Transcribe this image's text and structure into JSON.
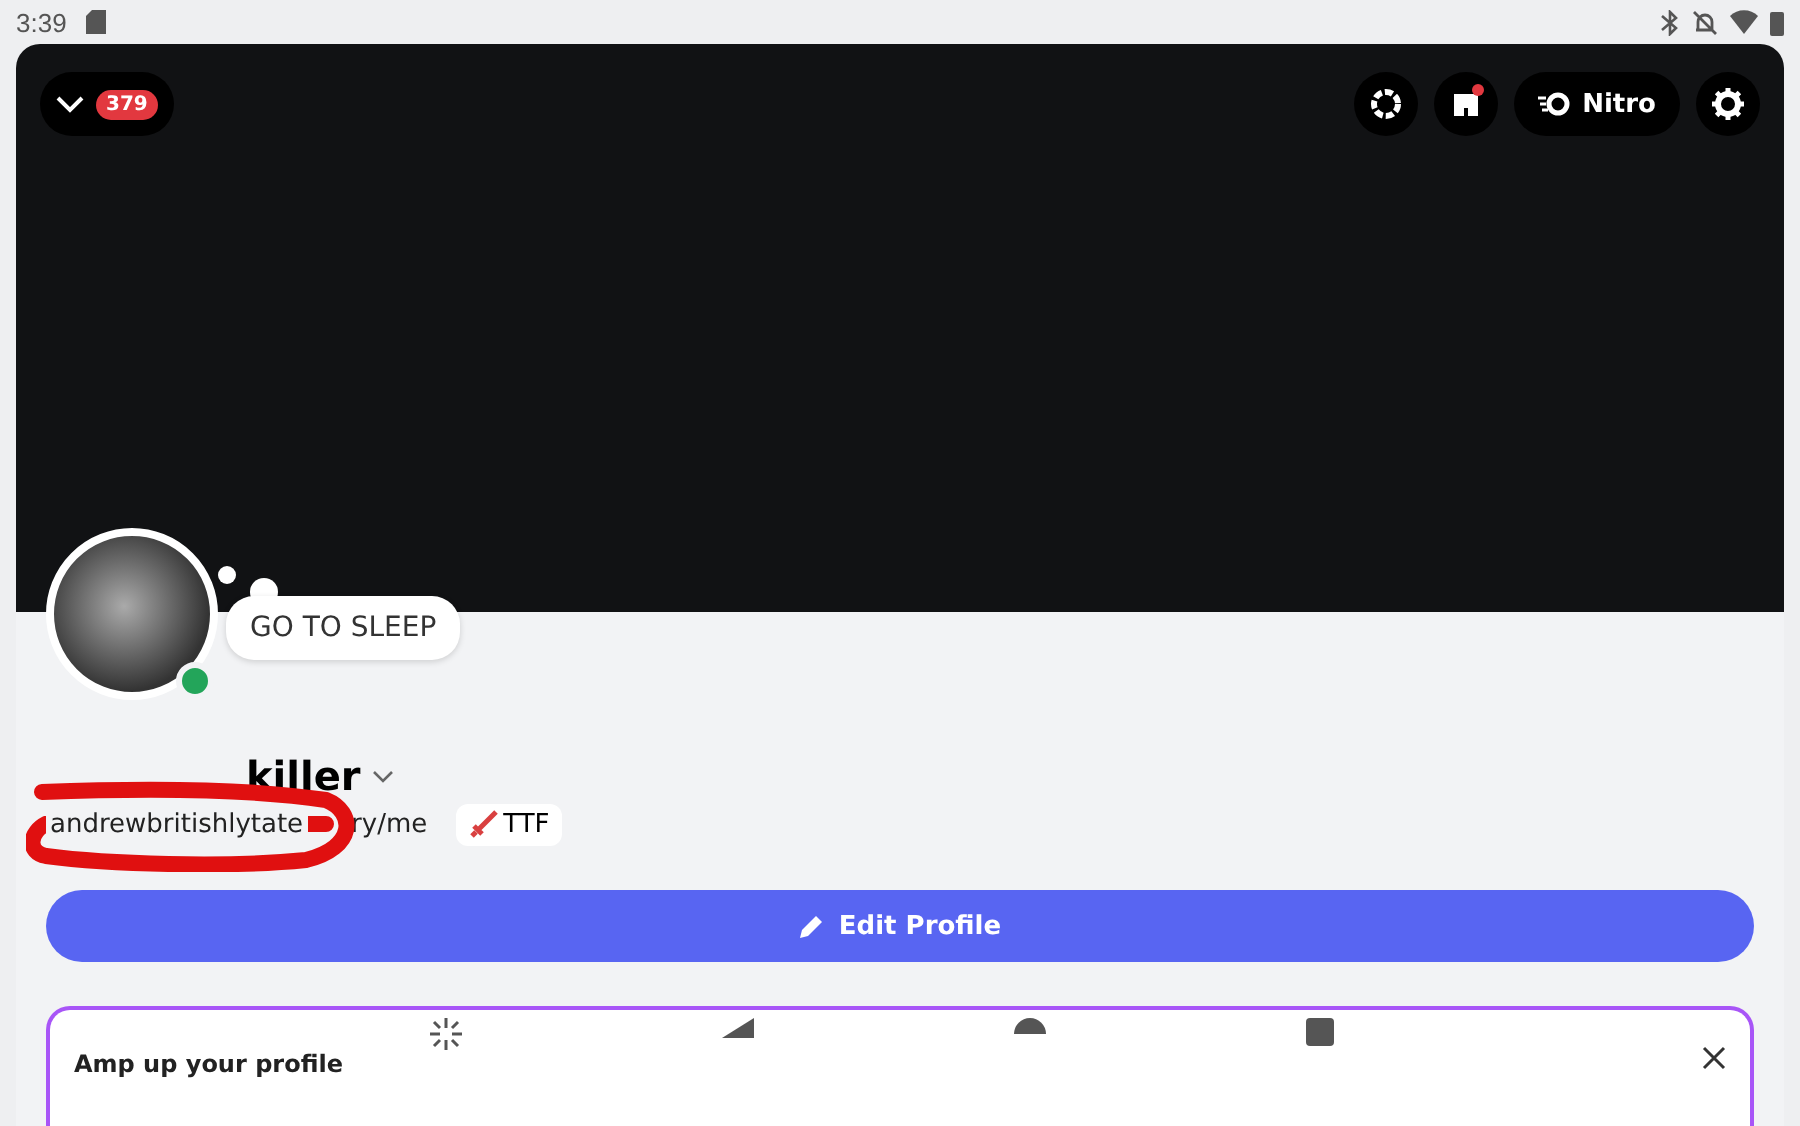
{
  "status_bar": {
    "time": "3:39"
  },
  "header": {
    "unread_count": "379",
    "nitro_label": "Nitro",
    "shop_has_dot": true
  },
  "profile": {
    "status_text": "GO TO SLEEP",
    "online": true,
    "display_name": "killer",
    "username": "andrewbritishlytate",
    "pronouns": "ry/me",
    "tag": {
      "label": "TTF"
    }
  },
  "edit_button": "Edit Profile",
  "promo_card": {
    "title": "Amp up your profile"
  }
}
